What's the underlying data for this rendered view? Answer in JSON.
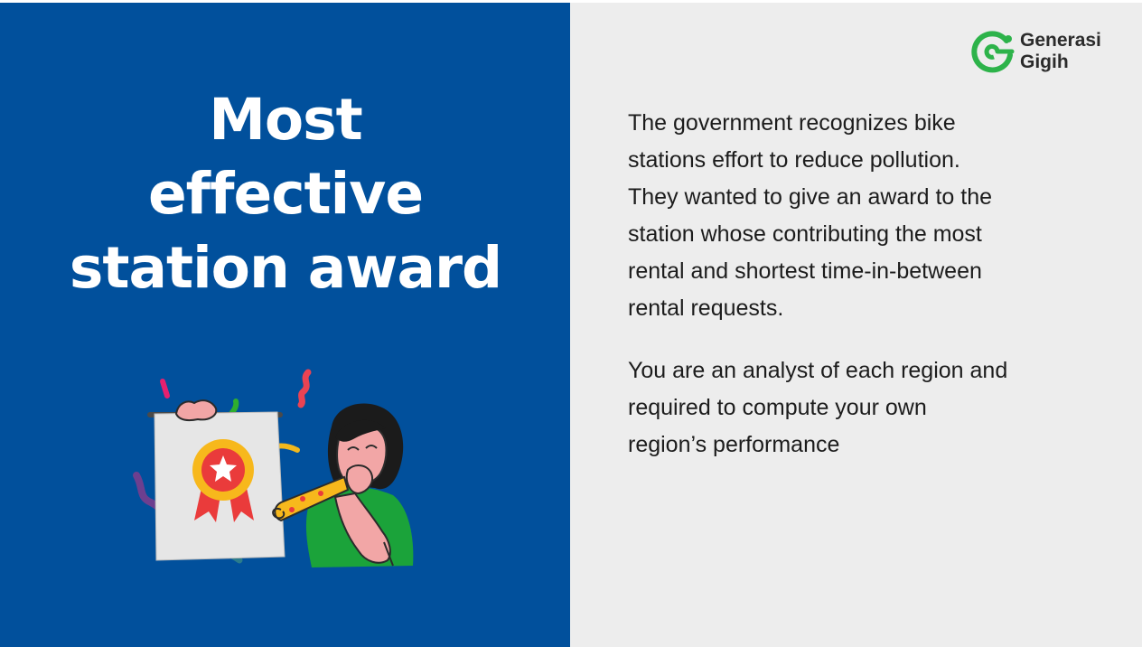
{
  "title_lines": [
    "Most",
    "effective",
    "station award"
  ],
  "logo": {
    "line1": "Generasi",
    "line2": "Gigih",
    "color": "#2db34a"
  },
  "paragraph1_lines": [
    "The government recognizes bike",
    "stations effort to reduce pollution.",
    "They wanted to give an award to the",
    "station whose contributing the most",
    "rental and shortest time-in-between",
    "rental requests."
  ],
  "paragraph2_lines": [
    "You are an analyst of each region and",
    "required to compute your own",
    "region’s performance"
  ],
  "illustration": {
    "subject": "woman-holding-award-certificate",
    "icon": "award-ribbon-icon"
  },
  "colors": {
    "left_panel": "#01509c",
    "right_panel": "#ededed",
    "title": "#ffffff",
    "body_text": "#1c1c1c"
  }
}
